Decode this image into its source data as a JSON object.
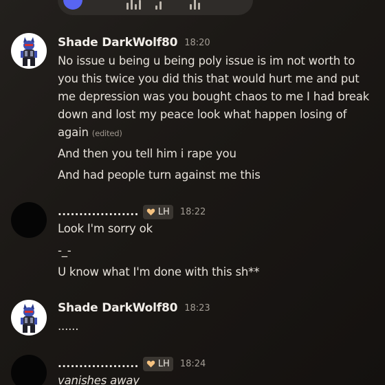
{
  "voice_message": {
    "play_icon": "play-icon",
    "waveform_icon": "waveform-icon"
  },
  "messages": [
    {
      "author": "Shade DarkWolf80",
      "time": "18:20",
      "avatar": "wolf-avatar",
      "lines": [
        "No issue u being u being poly issue is im not worth to",
        "you this twice you did this that would hurt me and put",
        "me depression was you bought chaos to me  I had break",
        "down and lost my peace look what happen losing of",
        "again",
        "And then you tell him i rape you",
        "And had people turn against me this"
      ],
      "edited_label": "(edited)"
    },
    {
      "author": "...................",
      "badge": "LH",
      "time": "18:22",
      "avatar": "black-avatar",
      "lines": [
        "Look I'm sorry ok",
        "-_-",
        "U know what I'm done with this sh**"
      ]
    },
    {
      "author": "Shade DarkWolf80",
      "time": "18:23",
      "avatar": "wolf-avatar",
      "lines": [
        "......"
      ]
    },
    {
      "author": "...................",
      "badge": "LH",
      "time": "18:24",
      "avatar": "black-avatar",
      "lines": [
        "vanishes away"
      ]
    }
  ],
  "colors": {
    "badge_heart": "#f5c280",
    "play_button": "#5865f2"
  }
}
